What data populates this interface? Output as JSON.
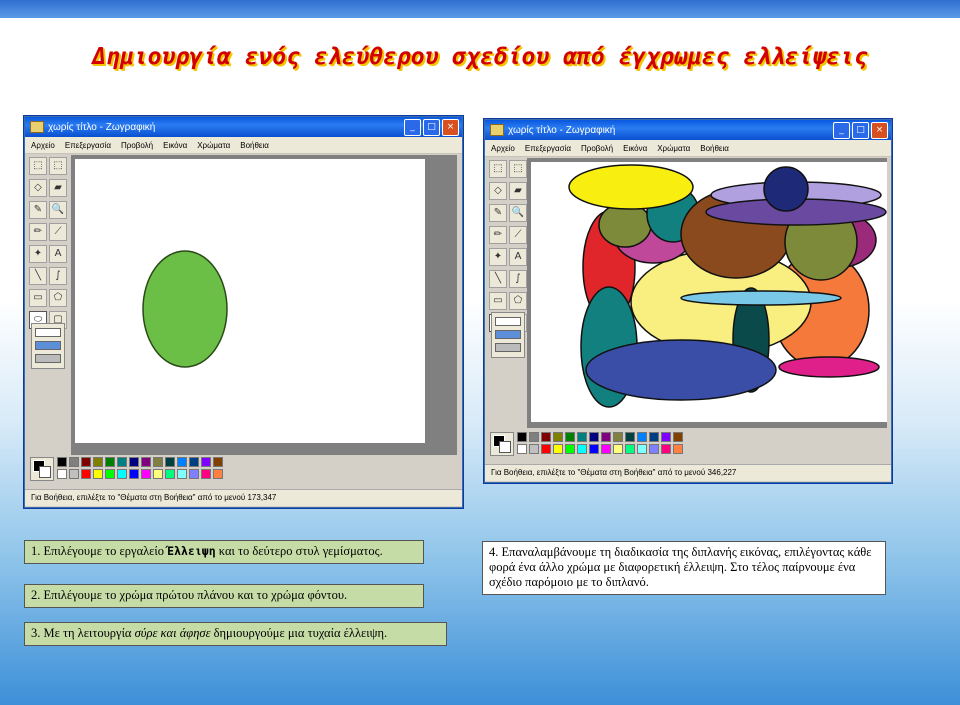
{
  "slide_title": "Δημιουργία ενός ελεύθερου σχεδίου από έγχρωμες ελλείψεις",
  "paint_left": {
    "title": "χωρίς τίτλο - Ζωγραφική",
    "menu": [
      "Αρχείο",
      "Επεξεργασία",
      "Προβολή",
      "Εικόνα",
      "Χρώματα",
      "Βοήθεια"
    ],
    "status": "Για Βοήθεια, επιλέξτε το \"Θέματα στη Βοήθεια\" από το μενού 173,347"
  },
  "paint_right": {
    "title": "χωρίς τίτλο - Ζωγραφική",
    "menu": [
      "Αρχείο",
      "Επεξεργασία",
      "Προβολή",
      "Εικόνα",
      "Χρώματα",
      "Βοήθεια"
    ],
    "status": "Για Βοήθεια, επιλέξτε το \"Θέματα στη Βοήθεια\" από το μενού 346,227"
  },
  "window_buttons": {
    "minimize": "_",
    "maximize": "□",
    "close": "×"
  },
  "tool_glyphs": [
    "⬚",
    "⬚",
    "◇",
    "▰",
    "✎",
    "🔍",
    "✏",
    "⟋",
    "✦",
    "A",
    "╲",
    "∫",
    "▭",
    "⬠",
    "⬭",
    "▢"
  ],
  "palette_colors": [
    "#000000",
    "#808080",
    "#800000",
    "#808000",
    "#008000",
    "#008080",
    "#000080",
    "#800080",
    "#808040",
    "#004040",
    "#0080ff",
    "#004080",
    "#8000ff",
    "#804000",
    "#ffffff",
    "#c0c0c0",
    "#ff0000",
    "#ffff00",
    "#00ff00",
    "#00ffff",
    "#0000ff",
    "#ff00ff",
    "#ffff80",
    "#00ff80",
    "#80ffff",
    "#8080ff",
    "#ff0080",
    "#ff8040"
  ],
  "steps": {
    "step1": {
      "prefix": "1. Επιλέγουμε το εργαλείο ",
      "tool": "Έλλειψη",
      "suffix": " και το δεύτερο στυλ γεμίσματος."
    },
    "step2": {
      "text": "2. Επιλέγουμε το χρώμα πρώτου πλάνου και το χρώμα φόντου."
    },
    "step3": {
      "prefix": "3. Με τη λειτουργία ",
      "italic": "σύρε και άφησε",
      "suffix": " δημιουργούμε μια τυχαία έλλειψη."
    },
    "step4": {
      "text": "4. Επαναλαμβάνουμε τη διαδικασία της διπλανής εικόνας, επιλέγοντας κάθε φορά ένα άλλο χρώμα με διαφορετική έλλειψη. Στο τέλος παίρνουμε ένα σχέδιο παρόμοιο με το διπλανό."
    }
  },
  "colors": {
    "title_red": "#d20000",
    "title_shadow": "#f4c400",
    "step_green": "#c6dca6",
    "ellipse_green": "#6bbf46"
  }
}
